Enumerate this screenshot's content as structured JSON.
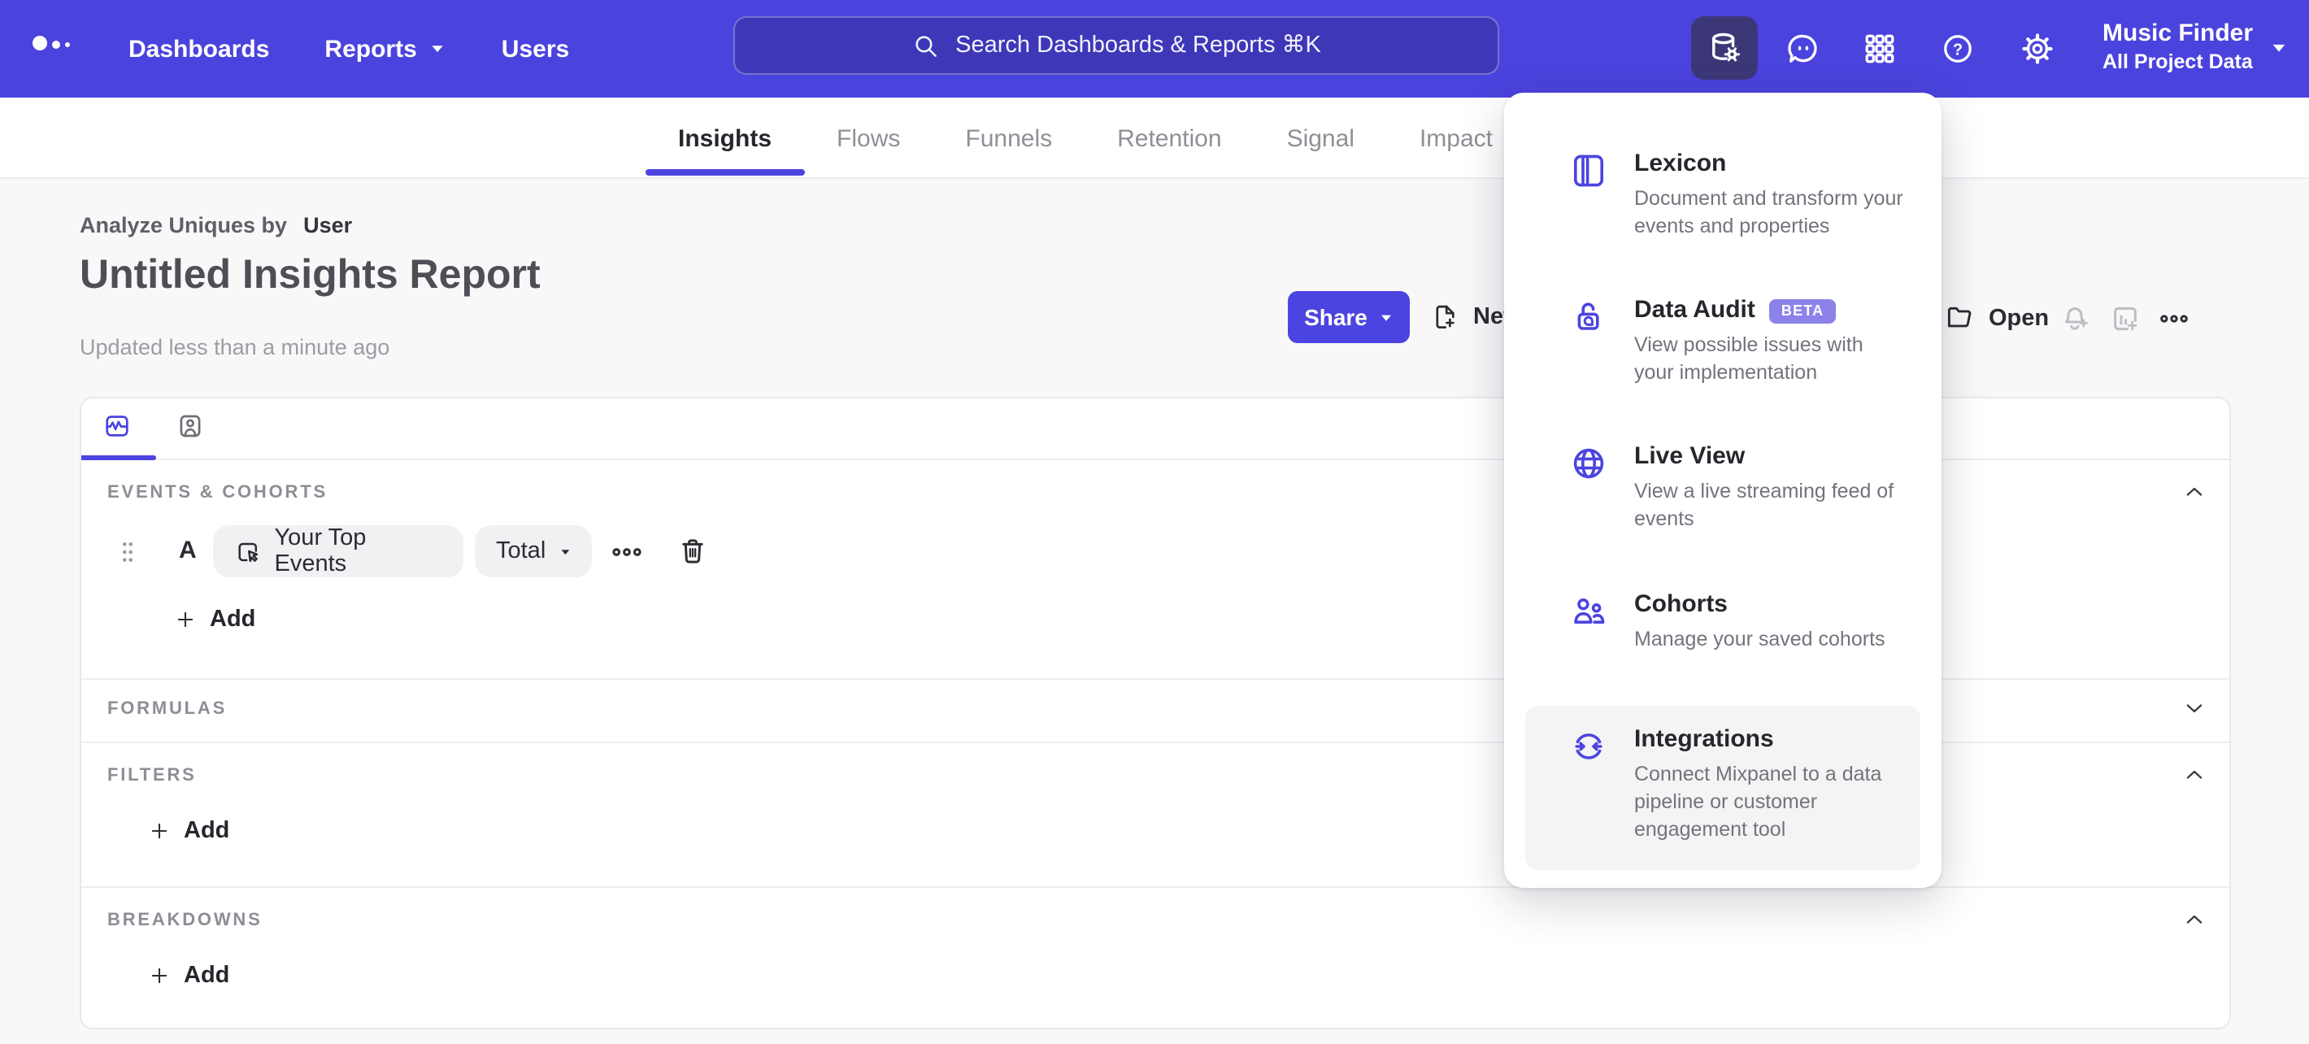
{
  "nav": {
    "items": [
      {
        "label": "Dashboards"
      },
      {
        "label": "Reports"
      },
      {
        "label": "Users"
      }
    ],
    "search_placeholder": "Search Dashboards & Reports ⌘K",
    "project": {
      "name": "Music Finder",
      "scope": "All Project Data"
    }
  },
  "tabs": {
    "items": [
      "Insights",
      "Flows",
      "Funnels",
      "Retention",
      "Signal",
      "Impact"
    ],
    "active": "Insights"
  },
  "report": {
    "analyze_label": "Analyze Uniques by",
    "analyze_value": "User",
    "title": "Untitled Insights Report",
    "updated": "Updated less than a minute ago"
  },
  "toolbar": {
    "share_label": "Share",
    "new_label": "New",
    "open_label": "Open"
  },
  "menu": {
    "items": [
      {
        "name": "Lexicon",
        "description": "Document and transform your events and properties"
      },
      {
        "name": "Data Audit",
        "badge": "BETA",
        "description": "View possible issues with your implementation"
      },
      {
        "name": "Live View",
        "description": "View a live streaming feed of events"
      },
      {
        "name": "Cohorts",
        "description": "Manage your saved cohorts"
      },
      {
        "name": "Integrations",
        "description": "Connect Mixpanel to a data pipeline or customer engagement tool",
        "highlighted": true
      }
    ]
  },
  "builder": {
    "sections": [
      {
        "label": "EVENTS & COHORTS",
        "collapsed": false
      },
      {
        "label": "FORMULAS",
        "collapsed": true
      },
      {
        "label": "FILTERS",
        "collapsed": false
      },
      {
        "label": "BREAKDOWNS",
        "collapsed": false
      }
    ],
    "event_row": {
      "letter": "A",
      "event": "Your Top Events",
      "aggregation": "Total"
    },
    "add_label": "Add"
  },
  "colors": {
    "accent": "#4C44E0",
    "nav_bg": "#4B43DE",
    "badge_bg": "#8C82E9"
  }
}
